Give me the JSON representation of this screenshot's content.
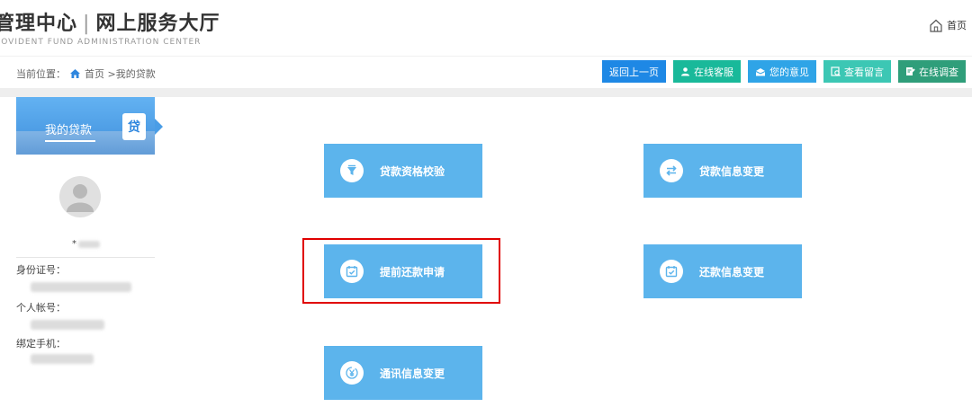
{
  "header": {
    "title_left": "管理中心",
    "title_right": "网上服务大厅",
    "subtitle": "ROVIDENT FUND ADMINISTRATION CENTER",
    "home_label": "首页"
  },
  "breadcrumb": {
    "prefix": "当前位置：",
    "path": "首页 >我的贷款"
  },
  "actions": [
    {
      "label": "返回上一页",
      "icon": "back-icon",
      "color": "#1e88e5"
    },
    {
      "label": "在线客服",
      "icon": "service-icon",
      "color": "#19b99a"
    },
    {
      "label": "您的意见",
      "icon": "mail-icon",
      "color": "#2fa4e7"
    },
    {
      "label": "查看留言",
      "icon": "message-icon",
      "color": "#3cc7b4"
    },
    {
      "label": "在线调查",
      "icon": "survey-icon",
      "color": "#2f9e7a"
    }
  ],
  "sidebar": {
    "title": "我的贷款",
    "badge": "贷",
    "username_prefix": "*",
    "fields": [
      {
        "label": "身份证号："
      },
      {
        "label": "个人帐号："
      },
      {
        "label": "绑定手机："
      }
    ]
  },
  "tiles": [
    {
      "label": "贷款资格校验",
      "icon": "filter-funnel-icon"
    },
    {
      "label": "贷款信息变更",
      "icon": "swap-arrows-icon"
    },
    {
      "label": "提前还款申请",
      "icon": "calendar-check-icon",
      "highlighted": true
    },
    {
      "label": "还款信息变更",
      "icon": "calendar-check-icon"
    },
    {
      "label": "通讯信息变更",
      "icon": "yen-refresh-icon"
    }
  ],
  "colors": {
    "tile": "#5cb4ec",
    "highlight": "#e00000",
    "sidebar_header": "#4a9de6"
  }
}
